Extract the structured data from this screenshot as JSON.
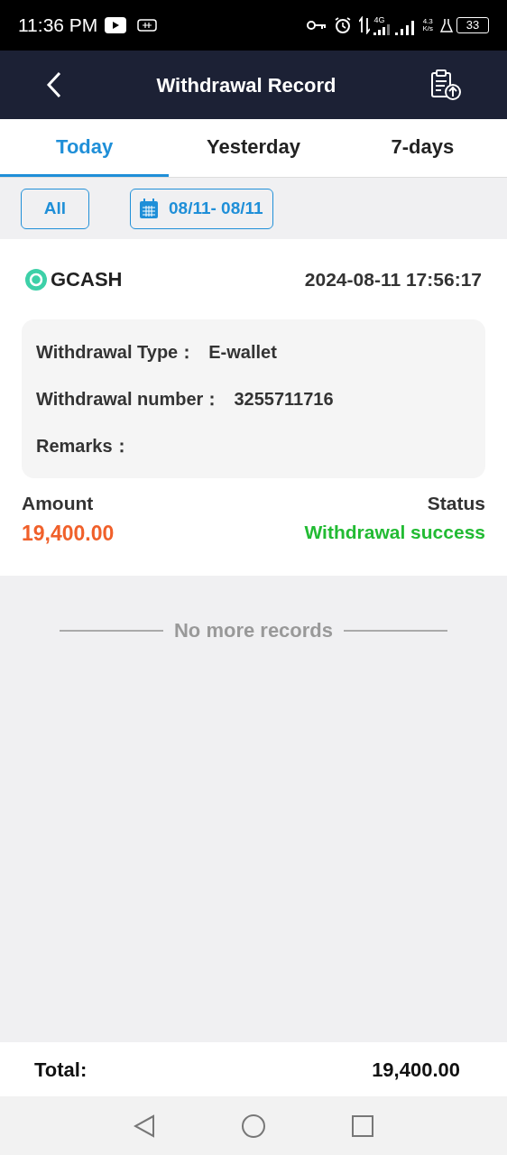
{
  "status_bar": {
    "time": "11:36 PM",
    "network": "4G",
    "speed_value": "4.3",
    "speed_unit": "K/s",
    "battery": "33"
  },
  "header": {
    "title": "Withdrawal Record"
  },
  "tabs": [
    {
      "label": "Today",
      "selected": true
    },
    {
      "label": "Yesterday",
      "selected": false
    },
    {
      "label": "7-days",
      "selected": false
    }
  ],
  "filters": {
    "type": "All",
    "date_range": "08/11- 08/11"
  },
  "records": [
    {
      "method": "GCASH",
      "datetime": "2024-08-11 17:56:17",
      "details": [
        {
          "label": "Withdrawal Type：",
          "value": "E-wallet"
        },
        {
          "label": "Withdrawal number：",
          "value": "3255711716"
        },
        {
          "label": "Remarks："
        }
      ],
      "amount_label": "Amount",
      "amount": "19,400.00",
      "status_label": "Status",
      "status": "Withdrawal success"
    }
  ],
  "end_note": "No more records",
  "footer": {
    "label": "Total:",
    "value": "19,400.00"
  }
}
